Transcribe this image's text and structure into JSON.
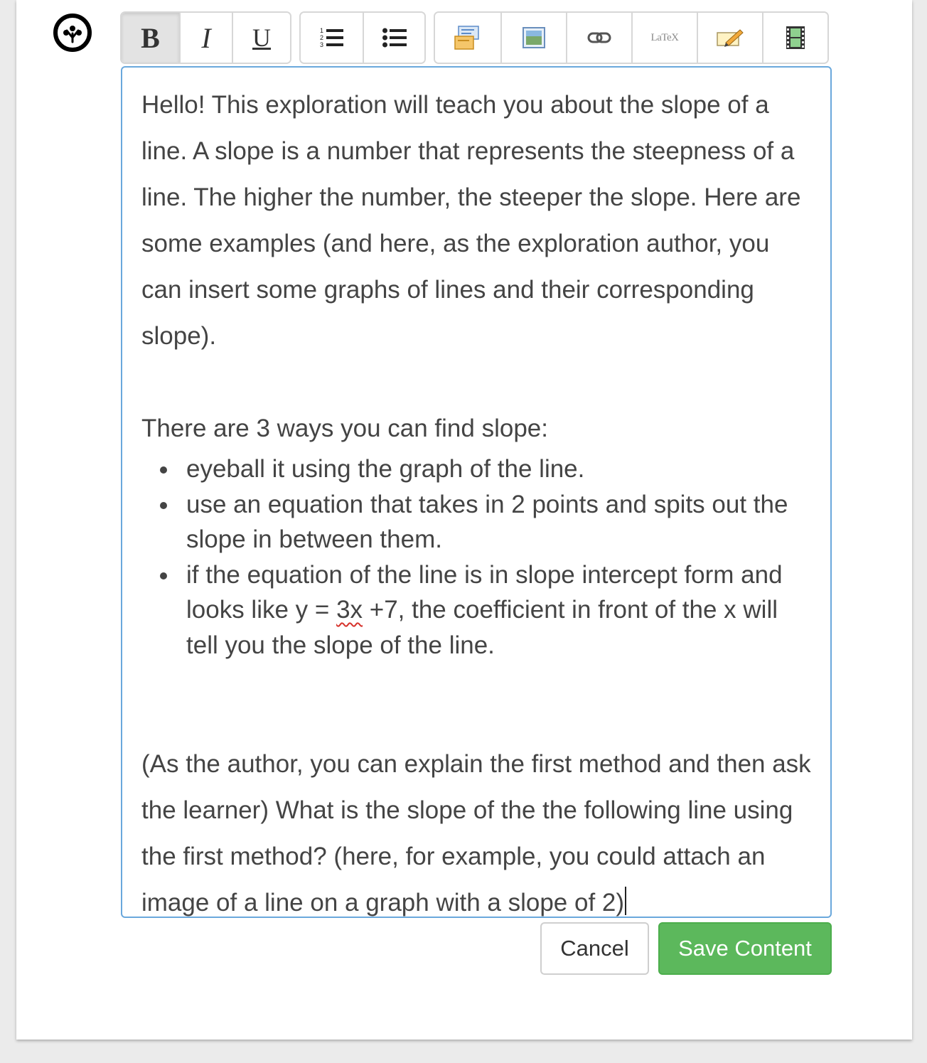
{
  "toolbar": {
    "bold_label": "B",
    "italic_label": "I",
    "underline_label": "U",
    "latex_label": "LaTeX",
    "groups": [
      [
        "bold",
        "italic",
        "underline"
      ],
      [
        "numbered-list",
        "bulleted-list"
      ],
      [
        "collapsible",
        "image",
        "link",
        "latex",
        "tabs",
        "video"
      ]
    ],
    "active": "bold"
  },
  "editor": {
    "intro": "Hello! This exploration will teach you about the slope of a line. A slope is a number that represents the steepness of a line. The higher the number, the steeper the slope. Here are some examples (and here, as the exploration author, you can insert some graphs of lines and their corresponding slope).",
    "ways_heading": "There are 3 ways you can find slope:",
    "list_items": [
      "eyeball it using the graph of the line.",
      "use an equation that takes in 2 points and spits out the slope in between them."
    ],
    "item3_before": "if the equation of the line is in slope intercept form and looks like y = ",
    "item3_misspelled": "3x",
    "item3_after": " +7, the coefficient in front of the x will tell you the slope of the line.",
    "closing": "(As the author, you can explain the first method and then ask the learner) What is the slope of the the following line using the first method? (here, for example, you could attach an image of a line on a graph with a slope of 2)"
  },
  "buttons": {
    "cancel": "Cancel",
    "save": "Save Content"
  },
  "colors": {
    "editor_border": "#6aa8dc",
    "save_bg": "#5cb85c",
    "text": "#444444"
  }
}
